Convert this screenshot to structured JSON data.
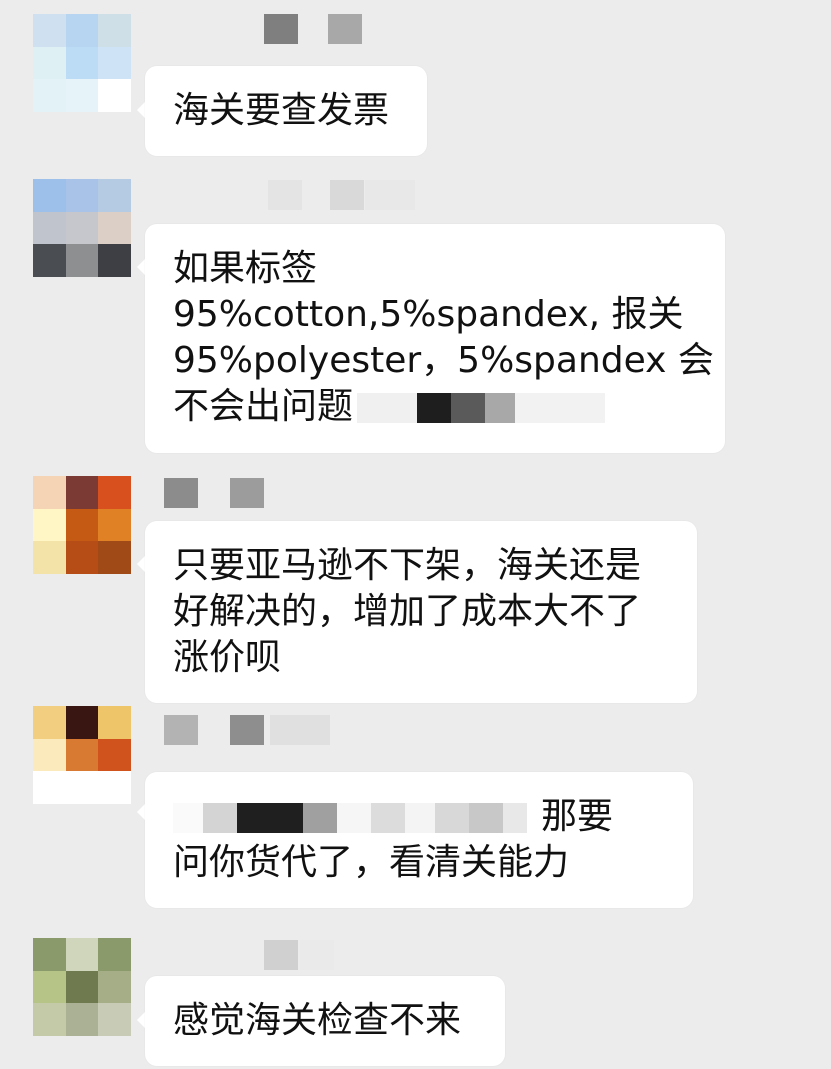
{
  "chat": {
    "messages": [
      {
        "id": 1,
        "avatar_colors": [
          "#cfe0f1",
          "#b7d4f0",
          "#cfdfe8",
          "#dff0f4",
          "#bcdcf6",
          "#cfe3f7",
          "#e2f2f6",
          "#e6f4fa",
          "#ffffff"
        ],
        "lines": [
          "海关要查发票"
        ]
      },
      {
        "id": 2,
        "avatar_colors": [
          "#9dc0ea",
          "#a9c2e8",
          "#b5cbe4",
          "#c0c4cc",
          "#c6c7cc",
          "#dcd0c6",
          "#4a4e52",
          "#8e8f90",
          "#3d3f44"
        ],
        "lines": [
          "如果标签",
          "95%cotton,5%spandex,   报关",
          "95%polyester，5%spandex 会",
          "不会出问题"
        ]
      },
      {
        "id": 3,
        "avatar_colors": [
          "#f4d4b5",
          "#7c3a35",
          "#d8501d",
          "#fff5c5",
          "#c55a14",
          "#e18125",
          "#f3e3a8",
          "#b64d16",
          "#a04a17"
        ],
        "lines": [
          "只要亚马逊不下架，海关还是",
          "好解决的，增加了成本大不了",
          "涨价呗"
        ]
      },
      {
        "id": 4,
        "avatar_colors": [
          "#f2cf80",
          "#3a1612",
          "#efc56a",
          "#fbebbc",
          "#d97a32",
          "#d0531e",
          "#ffffff",
          "#ffffff",
          "#ffffff"
        ],
        "lines": [
          "那要",
          "问你货代了，看清关能力"
        ]
      },
      {
        "id": 5,
        "avatar_colors": [
          "#8a9a6a",
          "#d0d6bb",
          "#8b9a6b",
          "#b7c488",
          "#6f7a4e",
          "#a6ae88",
          "#c4c9a8",
          "#aab194",
          "#c8cbb5"
        ],
        "lines": [
          "感觉海关检查不来"
        ]
      }
    ]
  }
}
